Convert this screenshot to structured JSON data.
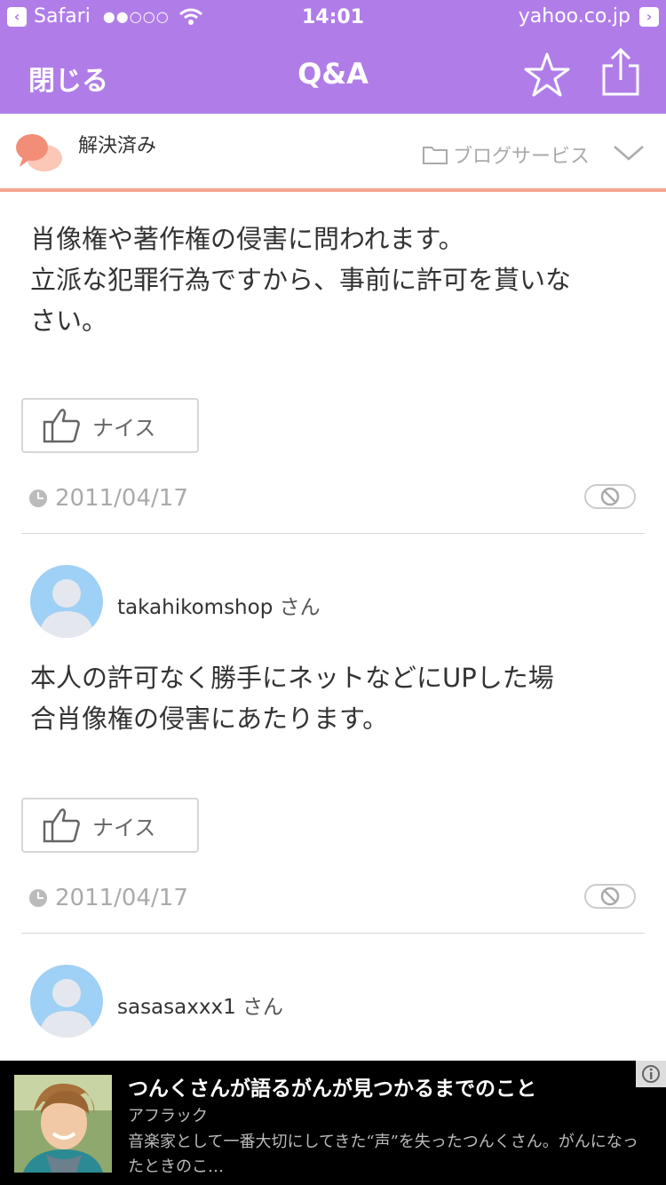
{
  "status_bar": {
    "back_app": "Safari",
    "signal": "●●○○○",
    "time": "14:01",
    "domain": "yahoo.co.jp"
  },
  "nav": {
    "close_label": "閉じる",
    "title": "Q&A"
  },
  "subheader": {
    "status": "解決済み",
    "category": "ブログサービス"
  },
  "answers": [
    {
      "text_lines": [
        "肖像権や著作権の侵害に問われます。",
        "立派な犯罪行為ですから、事前に許可を貰いな",
        "さい。"
      ],
      "nice_label": "ナイス",
      "date": "2011/04/17"
    },
    {
      "user": "takahikomshop",
      "suffix": "さん",
      "text_lines": [
        "本人の許可なく勝手にネットなどにUPした場",
        "合肖像権の侵害にあたります。"
      ],
      "nice_label": "ナイス",
      "date": "2011/04/17"
    },
    {
      "user": "sasasaxxx1",
      "suffix": "さん"
    }
  ],
  "ad": {
    "title": "つんくさんが語るがんが見つかるまでのこと",
    "sponsor": "アフラック",
    "description": "音楽家として一番大切にしてきた“声”を失ったつんくさん。がんになったときのこ…"
  },
  "colors": {
    "accent": "#b07de8",
    "divider_orange": "#f4a690"
  }
}
